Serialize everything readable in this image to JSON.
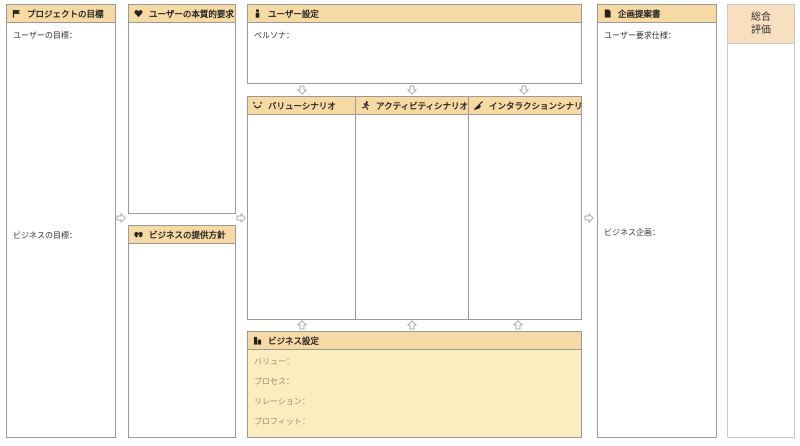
{
  "panels": {
    "project_goal": {
      "title": "プロジェクトの目標",
      "icon": "flag-icon",
      "user_goal_label": "ユーザーの目標：",
      "business_goal_label": "ビジネスの目標："
    },
    "user_needs": {
      "title": "ユーザーの本質的要求",
      "icon": "heart-icon"
    },
    "business_policy": {
      "title": "ビジネスの提供方針",
      "icon": "handshake-icon"
    },
    "user_setting": {
      "title": "ユーザー設定",
      "icon": "person-icon",
      "persona_label": "ペルソナ："
    },
    "value_scenario": {
      "title": "バリューシナリオ",
      "icon": "smile-icon"
    },
    "activity_scenario": {
      "title": "アクティビティシナリオ",
      "icon": "running-icon"
    },
    "interaction_scenario": {
      "title": "インタラクションシナリオ",
      "icon": "hand-pointer-icon"
    },
    "business_setting": {
      "title": "ビジネス設定",
      "icon": "building-icon",
      "items": [
        "バリュー：",
        "プロセス：",
        "リレーション：",
        "プロフィット："
      ]
    },
    "proposal": {
      "title": "企画提案書",
      "icon": "document-icon",
      "user_req_label": "ユーザー要求仕様：",
      "business_plan_label": "ビジネス企画："
    },
    "overall": {
      "title": "総合\n評価"
    }
  },
  "colors": {
    "header_bg": "#f7d9a3",
    "business_bg": "#faeebf",
    "overall_header_bg": "#f8dfc0",
    "border": "#9a9a9a"
  }
}
